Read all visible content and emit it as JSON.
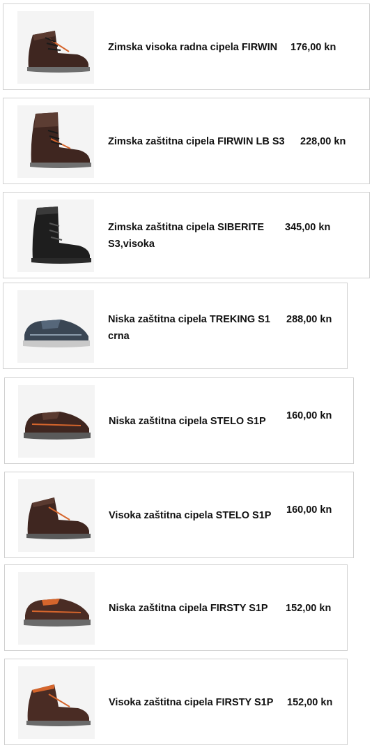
{
  "products": [
    {
      "name": "Zimska visoka radna cipela FIRWIN",
      "price": "176,00 kn",
      "image": "brown-high-work-boot-icon"
    },
    {
      "name": "Zimska zaštitna cipela FIRWIN LB S3",
      "price": "228,00 kn",
      "image": "brown-tall-winter-boot-icon"
    },
    {
      "name": "Zimska zaštitna cipela SIBERITE S3,visoka",
      "price": "345,00 kn",
      "image": "black-tall-winter-boot-icon"
    },
    {
      "name": "Niska zaštitna cipela TREKING S1 crna",
      "price": "288,00 kn",
      "image": "grey-trekking-sneaker-icon"
    },
    {
      "name": "Niska zaštitna cipela STELO S1P",
      "price": "160,00 kn",
      "image": "brown-low-shoe-icon"
    },
    {
      "name": "Visoka zaštitna cipela STELO S1P",
      "price": "160,00 kn",
      "image": "brown-high-boot-icon"
    },
    {
      "name": "Niska zaštitna cipela FIRSTY S1P",
      "price": "152,00 kn",
      "image": "brown-low-shoe-orange-trim-icon"
    },
    {
      "name": "Visoka zaštitna cipela FIRSTY S1P",
      "price": "152,00 kn",
      "image": "brown-high-boot-orange-trim-icon"
    }
  ],
  "colors": {
    "border": "#d0d0d0",
    "thumb_bg": "#f4f4f4",
    "brown_leather": "#4a2c24",
    "black_leather": "#1e1e1e",
    "orange_trim": "#d5652c"
  }
}
